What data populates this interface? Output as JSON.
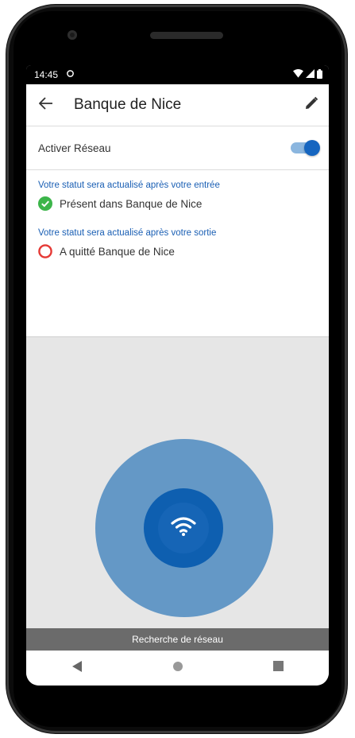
{
  "statusbar": {
    "time": "14:45",
    "sync_icon": "sync-icon",
    "wifi_icon": "wifi-icon",
    "signal_icon": "signal-icon",
    "battery_icon": "battery-icon"
  },
  "appbar": {
    "title": "Banque de Nice",
    "back_icon": "arrow-back-icon",
    "edit_icon": "pencil-icon"
  },
  "network_toggle": {
    "label": "Activer Réseau",
    "enabled": true
  },
  "entry_status": {
    "caption": "Votre statut sera actualisé après votre entrée",
    "text": "Présent dans Banque de Nice",
    "state": "present"
  },
  "exit_status": {
    "caption": "Votre statut sera actualisé après votre sortie",
    "text": "A quitté Banque de Nice",
    "state": "left"
  },
  "scanner": {
    "icon": "wifi-icon"
  },
  "bottom_bar": {
    "text": "Recherche de réseau"
  },
  "navbar": {
    "back": "nav-back-icon",
    "home": "nav-home-icon",
    "recents": "nav-recents-icon"
  },
  "colors": {
    "accent": "#1565c0",
    "caption": "#1a5fb4",
    "present": "#3cb54a",
    "left": "#e53935",
    "outer_circle": "#6498c6",
    "inner_circle": "#0e5fb0",
    "bottom_bar": "#6b6b6b"
  }
}
